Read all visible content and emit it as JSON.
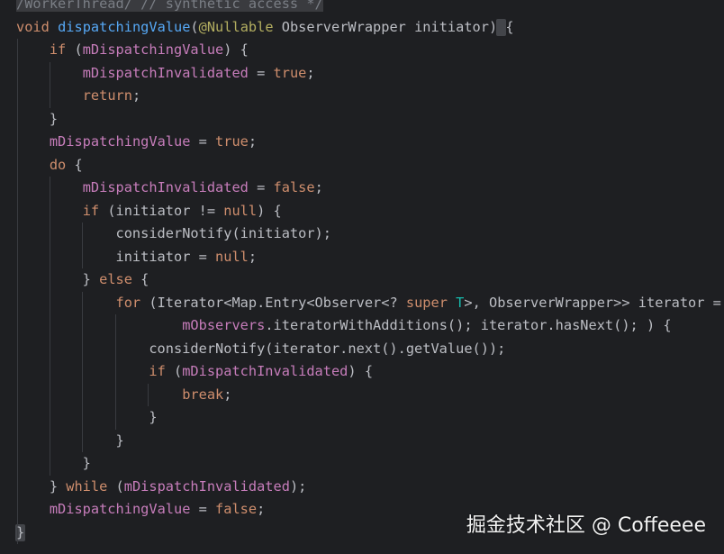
{
  "colors": {
    "background": "#1e1f22",
    "keyword": "#cf8e6d",
    "function": "#56a8f5",
    "field": "#c77dbb",
    "annotation": "#b3ae60",
    "type_parameter": "#16baac",
    "plain": "#bcbec4",
    "comment": "#7a7e85"
  },
  "watermark": "掘金技术社区 @ Coffeeee",
  "lines": [
    [
      {
        "t": "/WorkerThread/ // synthetic access */",
        "c": "comment"
      }
    ],
    [
      {
        "t": "void",
        "c": "kw"
      },
      {
        "t": " ",
        "c": "plain"
      },
      {
        "t": "dispatchingValue",
        "c": "fn"
      },
      {
        "t": "(",
        "c": "plain"
      },
      {
        "t": "@Nullable",
        "c": "ann"
      },
      {
        "t": " ObserverWrapper initiator) {",
        "c": "plain"
      }
    ],
    [
      {
        "t": "    ",
        "c": "plain"
      },
      {
        "t": "if",
        "c": "kw"
      },
      {
        "t": " (",
        "c": "plain"
      },
      {
        "t": "mDispatchingValue",
        "c": "field"
      },
      {
        "t": ") {",
        "c": "plain"
      }
    ],
    [
      {
        "t": "        ",
        "c": "plain"
      },
      {
        "t": "mDispatchInvalidated",
        "c": "field"
      },
      {
        "t": " = ",
        "c": "plain"
      },
      {
        "t": "true",
        "c": "kw"
      },
      {
        "t": ";",
        "c": "plain"
      }
    ],
    [
      {
        "t": "        ",
        "c": "plain"
      },
      {
        "t": "return",
        "c": "kw"
      },
      {
        "t": ";",
        "c": "plain"
      }
    ],
    [
      {
        "t": "    }",
        "c": "plain"
      }
    ],
    [
      {
        "t": "    ",
        "c": "plain"
      },
      {
        "t": "mDispatchingValue",
        "c": "field"
      },
      {
        "t": " = ",
        "c": "plain"
      },
      {
        "t": "true",
        "c": "kw"
      },
      {
        "t": ";",
        "c": "plain"
      }
    ],
    [
      {
        "t": "    ",
        "c": "plain"
      },
      {
        "t": "do",
        "c": "kw"
      },
      {
        "t": " {",
        "c": "plain"
      }
    ],
    [
      {
        "t": "        ",
        "c": "plain"
      },
      {
        "t": "mDispatchInvalidated",
        "c": "field"
      },
      {
        "t": " = ",
        "c": "plain"
      },
      {
        "t": "false",
        "c": "kw"
      },
      {
        "t": ";",
        "c": "plain"
      }
    ],
    [
      {
        "t": "        ",
        "c": "plain"
      },
      {
        "t": "if",
        "c": "kw"
      },
      {
        "t": " (initiator != ",
        "c": "plain"
      },
      {
        "t": "null",
        "c": "kw"
      },
      {
        "t": ") {",
        "c": "plain"
      }
    ],
    [
      {
        "t": "            considerNotify(initiator);",
        "c": "plain"
      }
    ],
    [
      {
        "t": "            initiator = ",
        "c": "plain"
      },
      {
        "t": "null",
        "c": "kw"
      },
      {
        "t": ";",
        "c": "plain"
      }
    ],
    [
      {
        "t": "        } ",
        "c": "plain"
      },
      {
        "t": "else",
        "c": "kw"
      },
      {
        "t": " {",
        "c": "plain"
      }
    ],
    [
      {
        "t": "            ",
        "c": "plain"
      },
      {
        "t": "for",
        "c": "kw"
      },
      {
        "t": " (Iterator<Map.Entry<Observer<? ",
        "c": "plain"
      },
      {
        "t": "super",
        "c": "kw"
      },
      {
        "t": " ",
        "c": "plain"
      },
      {
        "t": "T",
        "c": "tp"
      },
      {
        "t": ">, ObserverWrapper>> iterator =",
        "c": "plain"
      }
    ],
    [
      {
        "t": "                    ",
        "c": "plain"
      },
      {
        "t": "mObservers",
        "c": "field"
      },
      {
        "t": ".iteratorWithAdditions(); iterator.hasNext(); ) {",
        "c": "plain"
      }
    ],
    [
      {
        "t": "                considerNotify(iterator.next().getValue());",
        "c": "plain"
      }
    ],
    [
      {
        "t": "                ",
        "c": "plain"
      },
      {
        "t": "if",
        "c": "kw"
      },
      {
        "t": " (",
        "c": "plain"
      },
      {
        "t": "mDispatchInvalidated",
        "c": "field"
      },
      {
        "t": ") {",
        "c": "plain"
      }
    ],
    [
      {
        "t": "                    ",
        "c": "plain"
      },
      {
        "t": "break",
        "c": "kw"
      },
      {
        "t": ";",
        "c": "plain"
      }
    ],
    [
      {
        "t": "                }",
        "c": "plain"
      }
    ],
    [
      {
        "t": "            }",
        "c": "plain"
      }
    ],
    [
      {
        "t": "        }",
        "c": "plain"
      }
    ],
    [
      {
        "t": "    } ",
        "c": "plain"
      },
      {
        "t": "while",
        "c": "kw"
      },
      {
        "t": " (",
        "c": "plain"
      },
      {
        "t": "mDispatchInvalidated",
        "c": "field"
      },
      {
        "t": ");",
        "c": "plain"
      }
    ],
    [
      {
        "t": "    ",
        "c": "plain"
      },
      {
        "t": "mDispatchingValue",
        "c": "field"
      },
      {
        "t": " = ",
        "c": "plain"
      },
      {
        "t": "false",
        "c": "kw"
      },
      {
        "t": ";",
        "c": "plain"
      }
    ],
    [
      {
        "t": "}",
        "c": "plain"
      }
    ]
  ]
}
